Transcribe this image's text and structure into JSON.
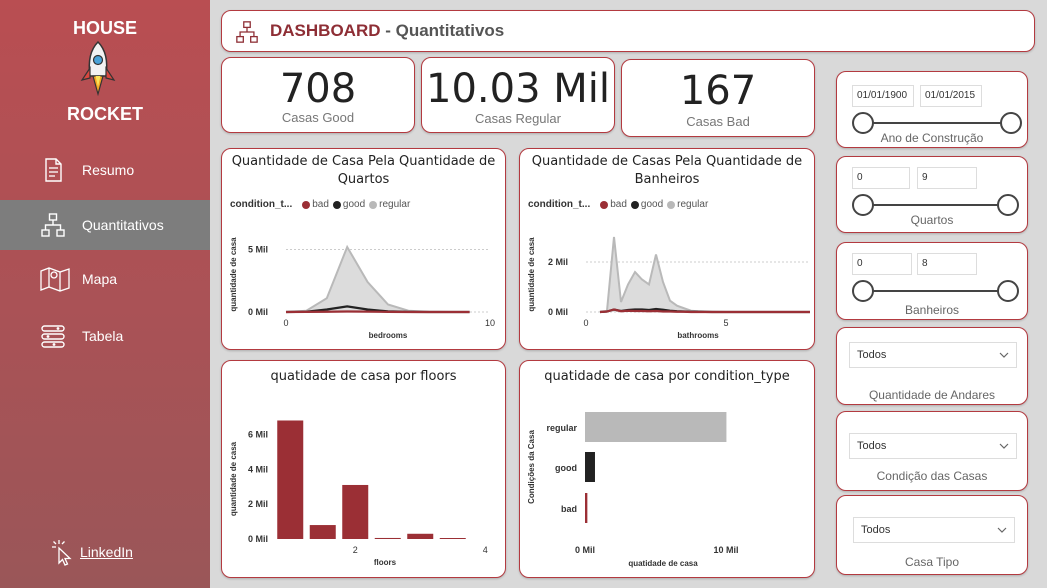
{
  "brand": {
    "line1": "HOUSE",
    "line2": "ROCKET"
  },
  "nav": [
    {
      "label": "Resumo",
      "icon": "document-icon"
    },
    {
      "label": "Quantitativos",
      "icon": "hierarchy-icon"
    },
    {
      "label": "Mapa",
      "icon": "map-icon"
    },
    {
      "label": "Tabela",
      "icon": "table-icon"
    }
  ],
  "linkedin": {
    "label": "LinkedIn"
  },
  "header": {
    "title_strong": "DASHBOARD",
    "title_rest": " - Quantitativos"
  },
  "kpis": [
    {
      "value": "708",
      "label": "Casas Good"
    },
    {
      "value": "10.03 Mil",
      "label": "Casas Regular"
    },
    {
      "value": "167",
      "label": "Casas Bad"
    }
  ],
  "colors": {
    "bad": "#9b2f35",
    "good": "#222222",
    "regular": "#b9b9b9",
    "accent": "#b33a40"
  },
  "chart_data": [
    {
      "type": "area",
      "title": "Quantidade de Casa Pela Quantidade de Quartos",
      "legend_title": "condition_t...",
      "xlabel": "bedrooms",
      "ylabel": "quantidade de casa",
      "x_ticks": [
        "0",
        "10"
      ],
      "y_ticks": [
        "0 Mil",
        "5 Mil"
      ],
      "xlim": [
        0,
        10
      ],
      "ylim": [
        0,
        6
      ],
      "x": [
        0,
        1,
        2,
        3,
        4,
        5,
        6,
        7,
        8,
        9
      ],
      "series": [
        {
          "name": "bad",
          "values": [
            0,
            0.01,
            0.02,
            0.04,
            0.03,
            0.01,
            0,
            0,
            0,
            0
          ]
        },
        {
          "name": "good",
          "values": [
            0,
            0.02,
            0.2,
            0.45,
            0.2,
            0.05,
            0.01,
            0,
            0,
            0
          ]
        },
        {
          "name": "regular",
          "values": [
            0,
            0.1,
            1.1,
            5.2,
            2.4,
            0.6,
            0.1,
            0.02,
            0,
            0
          ]
        }
      ]
    },
    {
      "type": "area",
      "title": "Quantidade de Casas Pela Quantidade de Banheiros",
      "legend_title": "condition_t...",
      "xlabel": "bathrooms",
      "ylabel": "quantidade de casa",
      "x_ticks": [
        "0",
        "5"
      ],
      "y_ticks": [
        "0 Mil",
        "2 Mil"
      ],
      "xlim": [
        0,
        8
      ],
      "ylim": [
        0,
        3
      ],
      "x": [
        0.5,
        0.75,
        1,
        1.25,
        1.5,
        1.75,
        2,
        2.25,
        2.5,
        2.75,
        3,
        3.25,
        3.5,
        3.75,
        4,
        4.5,
        5,
        5.5,
        6,
        7,
        8
      ],
      "series": [
        {
          "name": "bad",
          "values": [
            0,
            0.02,
            0.1,
            0.03,
            0.05,
            0.04,
            0.04,
            0.03,
            0.04,
            0.02,
            0.02,
            0.01,
            0.01,
            0,
            0,
            0,
            0,
            0,
            0,
            0,
            0
          ]
        },
        {
          "name": "good",
          "values": [
            0,
            0.02,
            0.1,
            0.04,
            0.08,
            0.1,
            0.1,
            0.08,
            0.12,
            0.09,
            0.05,
            0.03,
            0.02,
            0.01,
            0.01,
            0,
            0,
            0,
            0,
            0,
            0
          ]
        },
        {
          "name": "regular",
          "values": [
            0,
            0.05,
            3.0,
            0.4,
            1.1,
            1.6,
            1.3,
            1.1,
            2.3,
            1.2,
            0.45,
            0.25,
            0.15,
            0.05,
            0.03,
            0.01,
            0,
            0,
            0,
            0,
            0
          ]
        }
      ]
    },
    {
      "type": "bar",
      "title": "quatidade de casa por floors",
      "xlabel": "floors",
      "ylabel": "quantidade de casa",
      "x_ticks": [
        "2",
        "4"
      ],
      "y_ticks": [
        "0 Mil",
        "2 Mil",
        "4 Mil",
        "6 Mil"
      ],
      "ylim": [
        0,
        7
      ],
      "categories": [
        1,
        1.5,
        2,
        2.5,
        3,
        3.5
      ],
      "values": [
        6.8,
        0.8,
        3.1,
        0.06,
        0.3,
        0.04
      ]
    },
    {
      "type": "bar",
      "orientation": "horizontal",
      "title": "quatidade de casa por condition_type",
      "xlabel": "quatidade de casa",
      "ylabel": "Condições da Casa",
      "x_ticks": [
        "0 Mil",
        "10 Mil"
      ],
      "xlim": [
        0,
        10
      ],
      "categories": [
        "regular",
        "good",
        "bad"
      ],
      "values": [
        10.03,
        0.708,
        0.167
      ]
    }
  ],
  "filters": {
    "year": {
      "from": "01/01/1900",
      "to": "01/01/2015",
      "label": "Ano de Construção"
    },
    "rooms": {
      "from": "0",
      "to": "9",
      "label": "Quartos"
    },
    "baths": {
      "from": "0",
      "to": "8",
      "label": "Banheiros"
    },
    "floors": {
      "value": "Todos",
      "label": "Quantidade de Andares"
    },
    "condition": {
      "value": "Todos",
      "label": "Condição das Casas"
    },
    "type": {
      "value": "Todos",
      "label": "Casa Tipo"
    }
  }
}
